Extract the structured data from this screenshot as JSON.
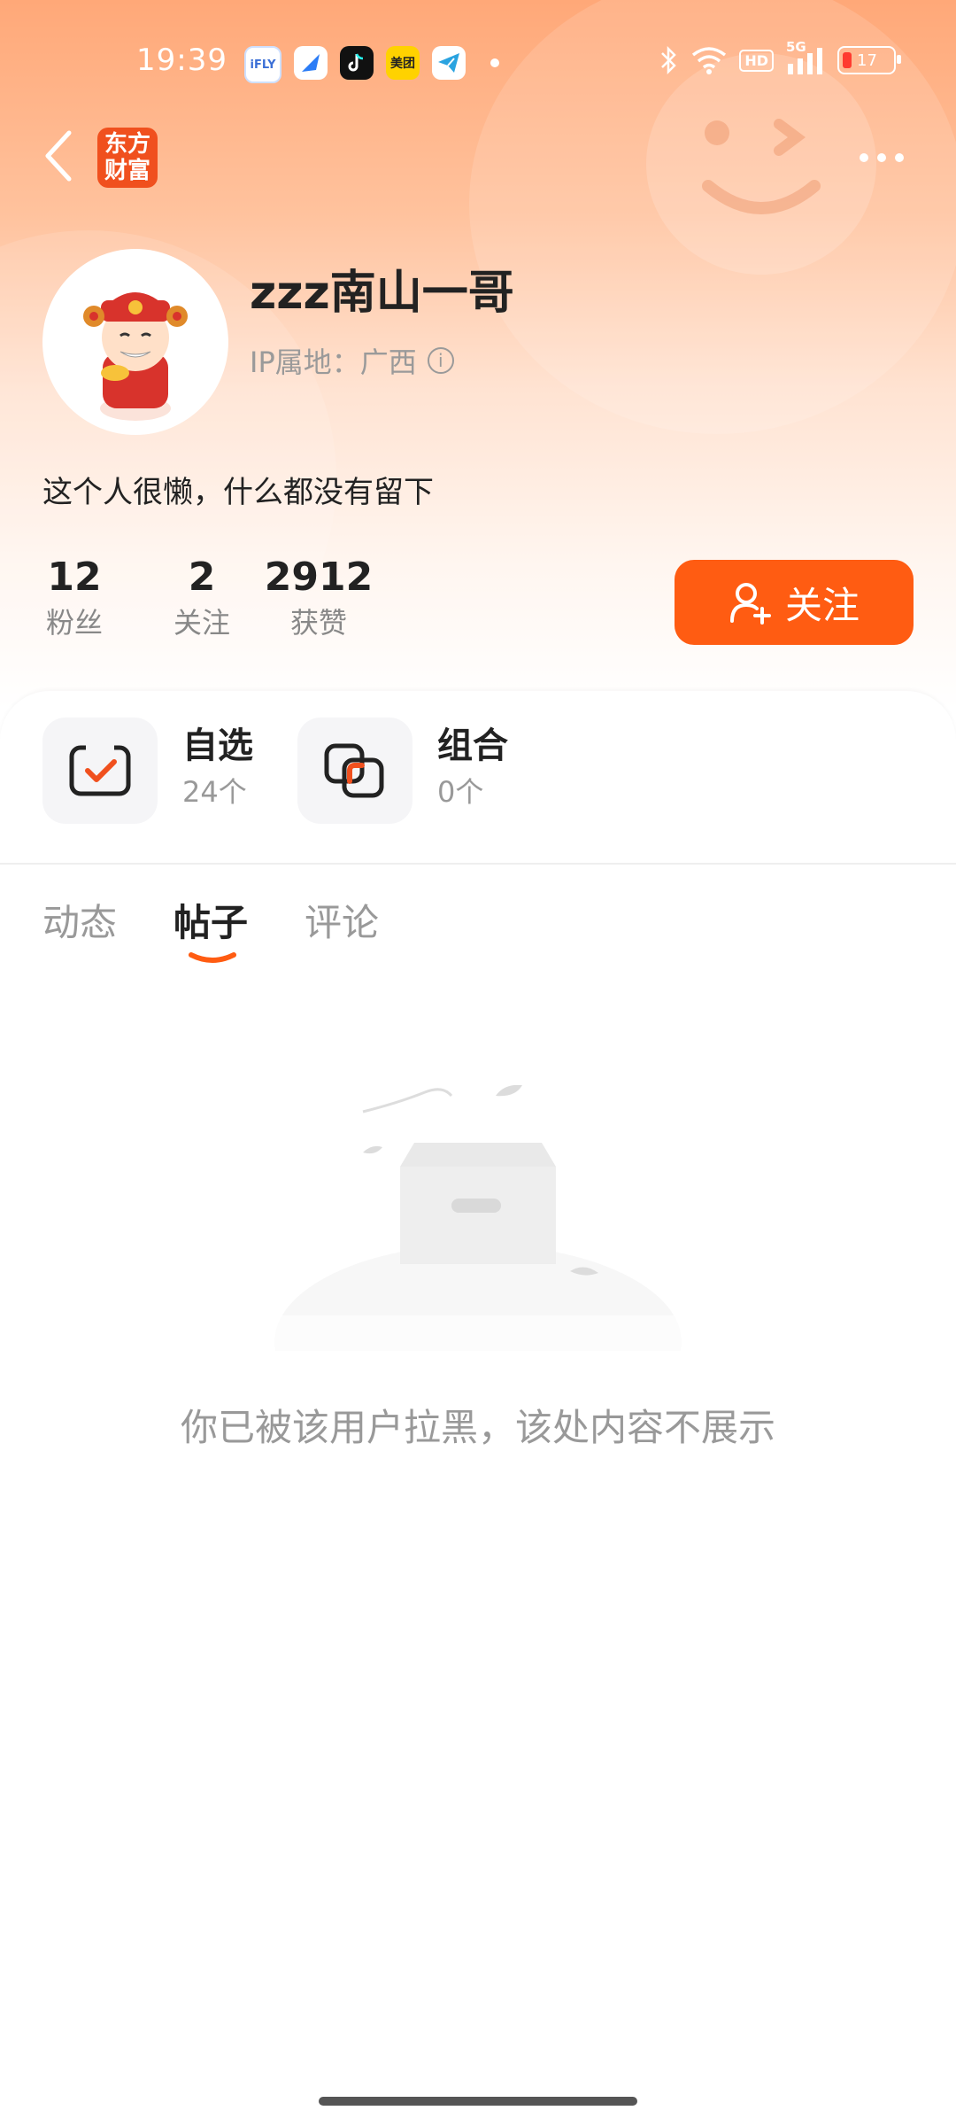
{
  "status_bar": {
    "time": "19:39",
    "notification_icons": [
      "ifly-icon",
      "browser-icon",
      "tiktok-icon",
      "meituan-icon",
      "telegram-icon"
    ],
    "notif_labels": {
      "ifly": "iFLY",
      "meituan": "美团"
    },
    "hd": "HD",
    "network": "5G",
    "battery": "17"
  },
  "nav": {
    "logo_line1": "东方",
    "logo_line2": "财富"
  },
  "profile": {
    "username": "zzz南山一哥",
    "ip_location": "IP属地：广西",
    "bio": "这个人很懒，什么都没有留下"
  },
  "stats": [
    {
      "value": "12",
      "label": "粉丝"
    },
    {
      "value": "2",
      "label": "关注"
    },
    {
      "value": "2912",
      "label": "获赞"
    }
  ],
  "follow_button": {
    "label": "关注"
  },
  "quick_entries": [
    {
      "title": "自选",
      "count": "24个"
    },
    {
      "title": "组合",
      "count": "0个"
    }
  ],
  "tabs": [
    {
      "label": "动态",
      "active": false
    },
    {
      "label": "帖子",
      "active": true
    },
    {
      "label": "评论",
      "active": false
    }
  ],
  "empty_state": {
    "message": "你已被该用户拉黑，该处内容不展示"
  },
  "colors": {
    "accent": "#ff5c12",
    "header_top": "#ffa878",
    "logo_bg": "#f0501e"
  }
}
